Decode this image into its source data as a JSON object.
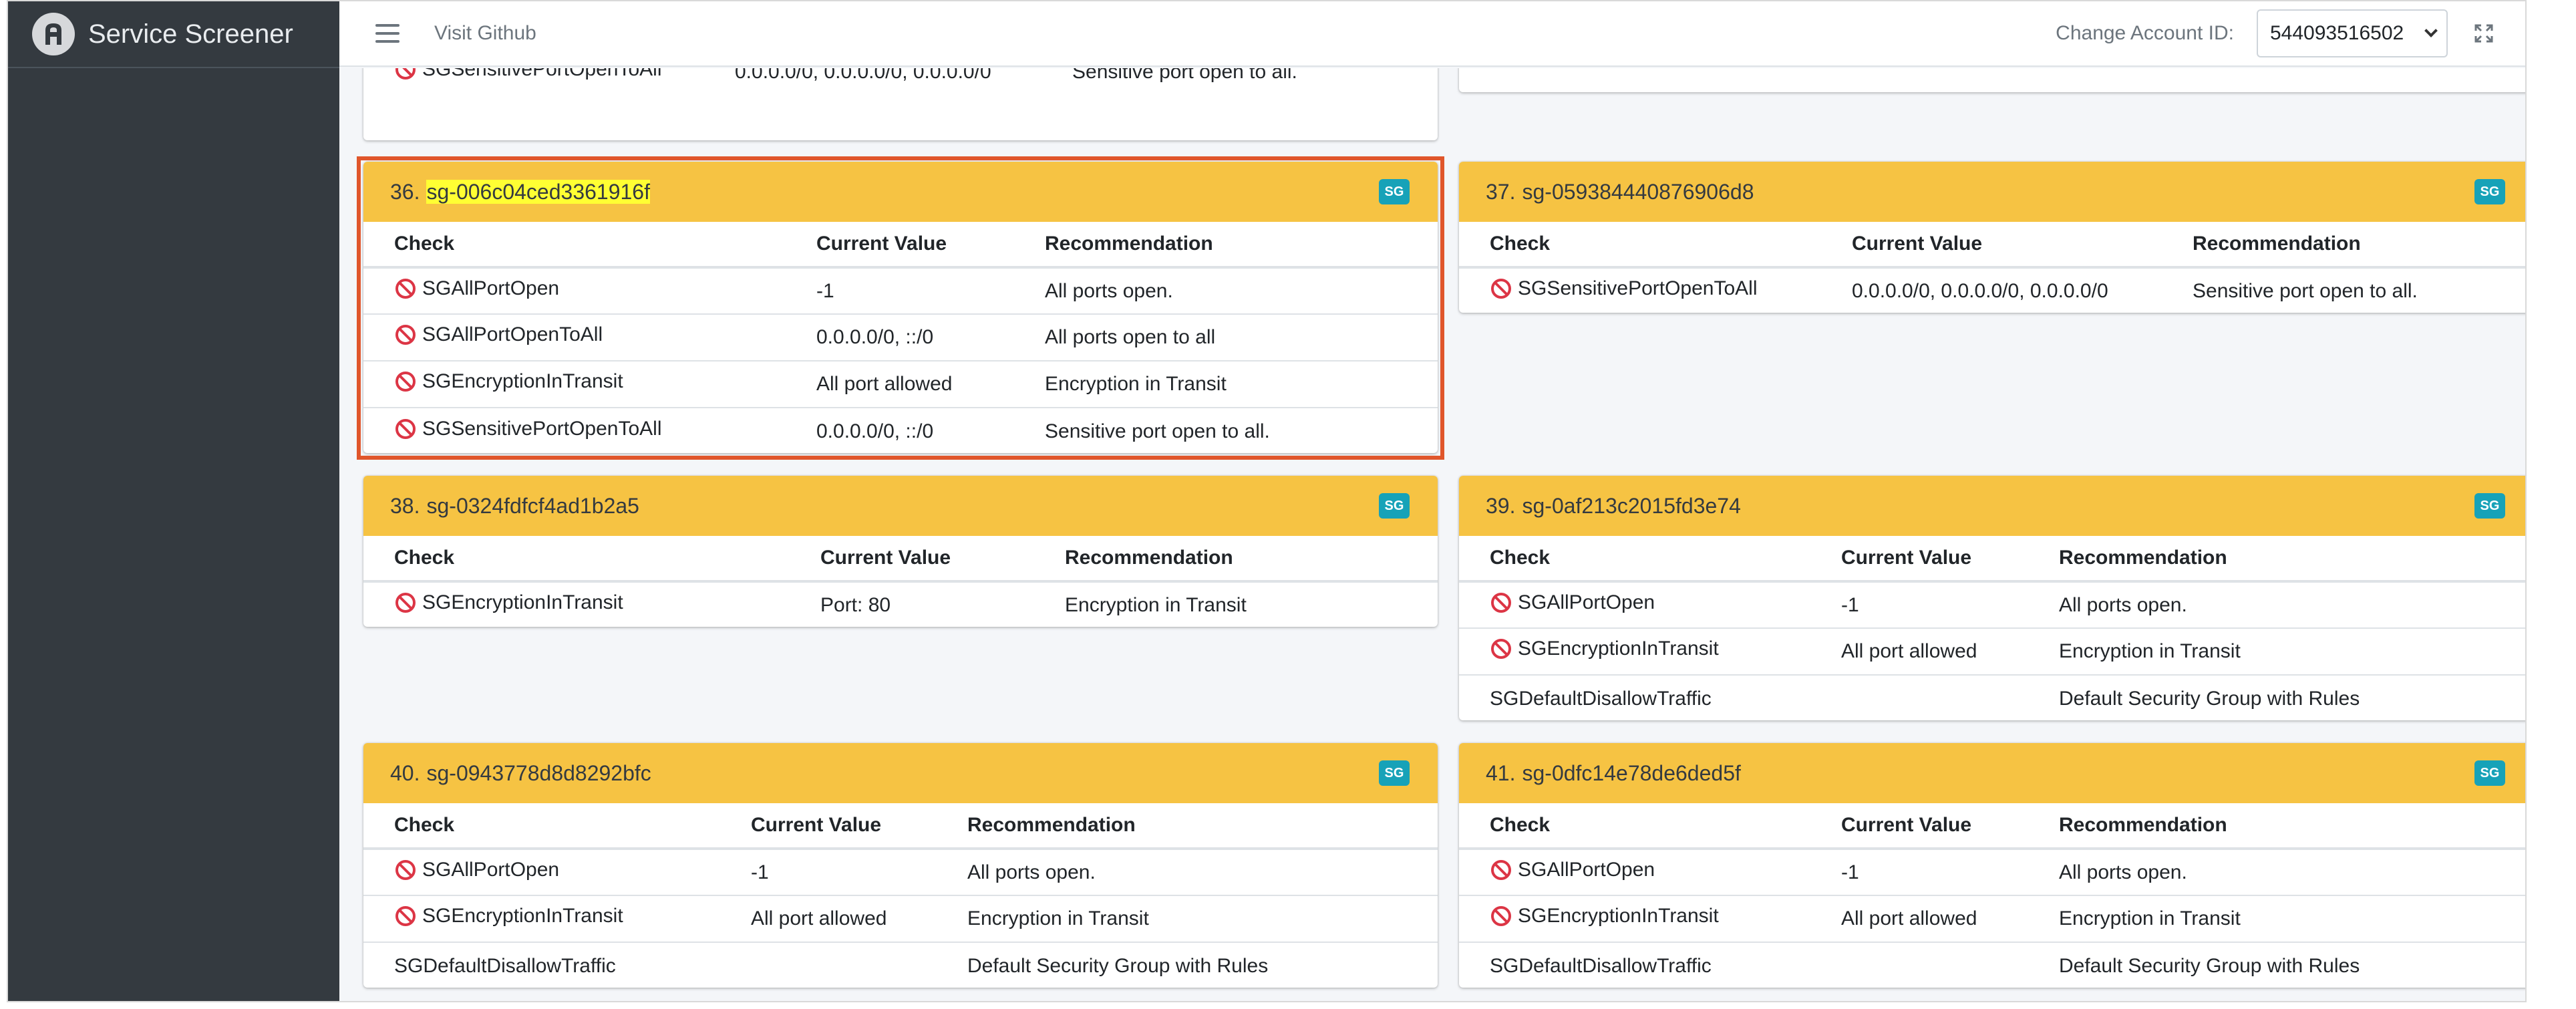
{
  "brand": {
    "name": "Service Screener"
  },
  "navbar": {
    "github_link": "Visit Github",
    "account_label": "Change Account ID:",
    "account_selected": "544093516502"
  },
  "colors": {
    "card_header": "#f6c343",
    "badge": "#17a2b8",
    "sidebar": "#343a40",
    "focus_border": "#e0562b",
    "highlight": "#ffff33"
  },
  "icons": {
    "brand": "brand-logo-icon",
    "menu": "hamburger-icon",
    "expand": "expand-icon",
    "status": "no-entry-icon",
    "select": "chevron-down-icon"
  },
  "cards": [
    {
      "num": "",
      "sg_id": "",
      "badge": "",
      "columns": [
        "",
        "",
        ""
      ],
      "rows": [
        {
          "check": "SGEncryptionInTransit",
          "value": "Port: 80",
          "recommendation": "Encryption in Transit",
          "flag": true
        },
        {
          "check": "SGSensitivePortOpenToAll",
          "value": "0.0.0.0/0, 0.0.0.0/0, 0.0.0.0/0",
          "recommendation": "Sensitive port open to all.",
          "flag": true
        }
      ]
    },
    {
      "num": "",
      "sg_id": "",
      "badge": "",
      "columns": [
        "",
        "",
        ""
      ],
      "rows": [
        {
          "check": "SGSensitivePortOpenToAll",
          "value": "0.0.0.0/0, 0.0.0.0/0",
          "recommendation": "Sensitive port open to all.",
          "flag": true
        }
      ]
    },
    {
      "num": "36.",
      "sg_id": "sg-006c04ced3361916f",
      "badge": "SG",
      "columns": [
        "Check",
        "Current Value",
        "Recommendation"
      ],
      "rows": [
        {
          "check": "SGAllPortOpen",
          "value": "-1",
          "recommendation": "All ports open.",
          "flag": true
        },
        {
          "check": "SGAllPortOpenToAll",
          "value": "0.0.0.0/0, ::/0",
          "recommendation": "All ports open to all",
          "flag": true
        },
        {
          "check": "SGEncryptionInTransit",
          "value": "All port allowed",
          "recommendation": "Encryption in Transit",
          "flag": true
        },
        {
          "check": "SGSensitivePortOpenToAll",
          "value": "0.0.0.0/0, ::/0",
          "recommendation": "Sensitive port open to all.",
          "flag": true
        }
      ]
    },
    {
      "num": "37.",
      "sg_id": "sg-059384440876906d8",
      "badge": "SG",
      "columns": [
        "Check",
        "Current Value",
        "Recommendation"
      ],
      "rows": [
        {
          "check": "SGSensitivePortOpenToAll",
          "value": "0.0.0.0/0, 0.0.0.0/0, 0.0.0.0/0",
          "recommendation": "Sensitive port open to all.",
          "flag": true
        }
      ]
    },
    {
      "num": "38.",
      "sg_id": "sg-0324fdfcf4ad1b2a5",
      "badge": "SG",
      "columns": [
        "Check",
        "Current Value",
        "Recommendation"
      ],
      "rows": [
        {
          "check": "SGEncryptionInTransit",
          "value": "Port: 80",
          "recommendation": "Encryption in Transit",
          "flag": true
        }
      ]
    },
    {
      "num": "39.",
      "sg_id": "sg-0af213c2015fd3e74",
      "badge": "SG",
      "columns": [
        "Check",
        "Current Value",
        "Recommendation"
      ],
      "rows": [
        {
          "check": "SGAllPortOpen",
          "value": "-1",
          "recommendation": "All ports open.",
          "flag": true
        },
        {
          "check": "SGEncryptionInTransit",
          "value": "All port allowed",
          "recommendation": "Encryption in Transit",
          "flag": true
        },
        {
          "check": "SGDefaultDisallowTraffic",
          "value": "",
          "recommendation": "Default Security Group with Rules",
          "flag": false
        }
      ]
    },
    {
      "num": "40.",
      "sg_id": "sg-0943778d8d8292bfc",
      "badge": "SG",
      "columns": [
        "Check",
        "Current Value",
        "Recommendation"
      ],
      "rows": [
        {
          "check": "SGAllPortOpen",
          "value": "-1",
          "recommendation": "All ports open.",
          "flag": true
        },
        {
          "check": "SGEncryptionInTransit",
          "value": "All port allowed",
          "recommendation": "Encryption in Transit",
          "flag": true
        },
        {
          "check": "SGDefaultDisallowTraffic",
          "value": "",
          "recommendation": "Default Security Group with Rules",
          "flag": false
        }
      ]
    },
    {
      "num": "41.",
      "sg_id": "sg-0dfc14e78de6ded5f",
      "badge": "SG",
      "columns": [
        "Check",
        "Current Value",
        "Recommendation"
      ],
      "rows": [
        {
          "check": "SGAllPortOpen",
          "value": "-1",
          "recommendation": "All ports open.",
          "flag": true
        },
        {
          "check": "SGEncryptionInTransit",
          "value": "All port allowed",
          "recommendation": "Encryption in Transit",
          "flag": true
        },
        {
          "check": "SGDefaultDisallowTraffic",
          "value": "",
          "recommendation": "Default Security Group with Rules",
          "flag": false
        }
      ]
    }
  ]
}
